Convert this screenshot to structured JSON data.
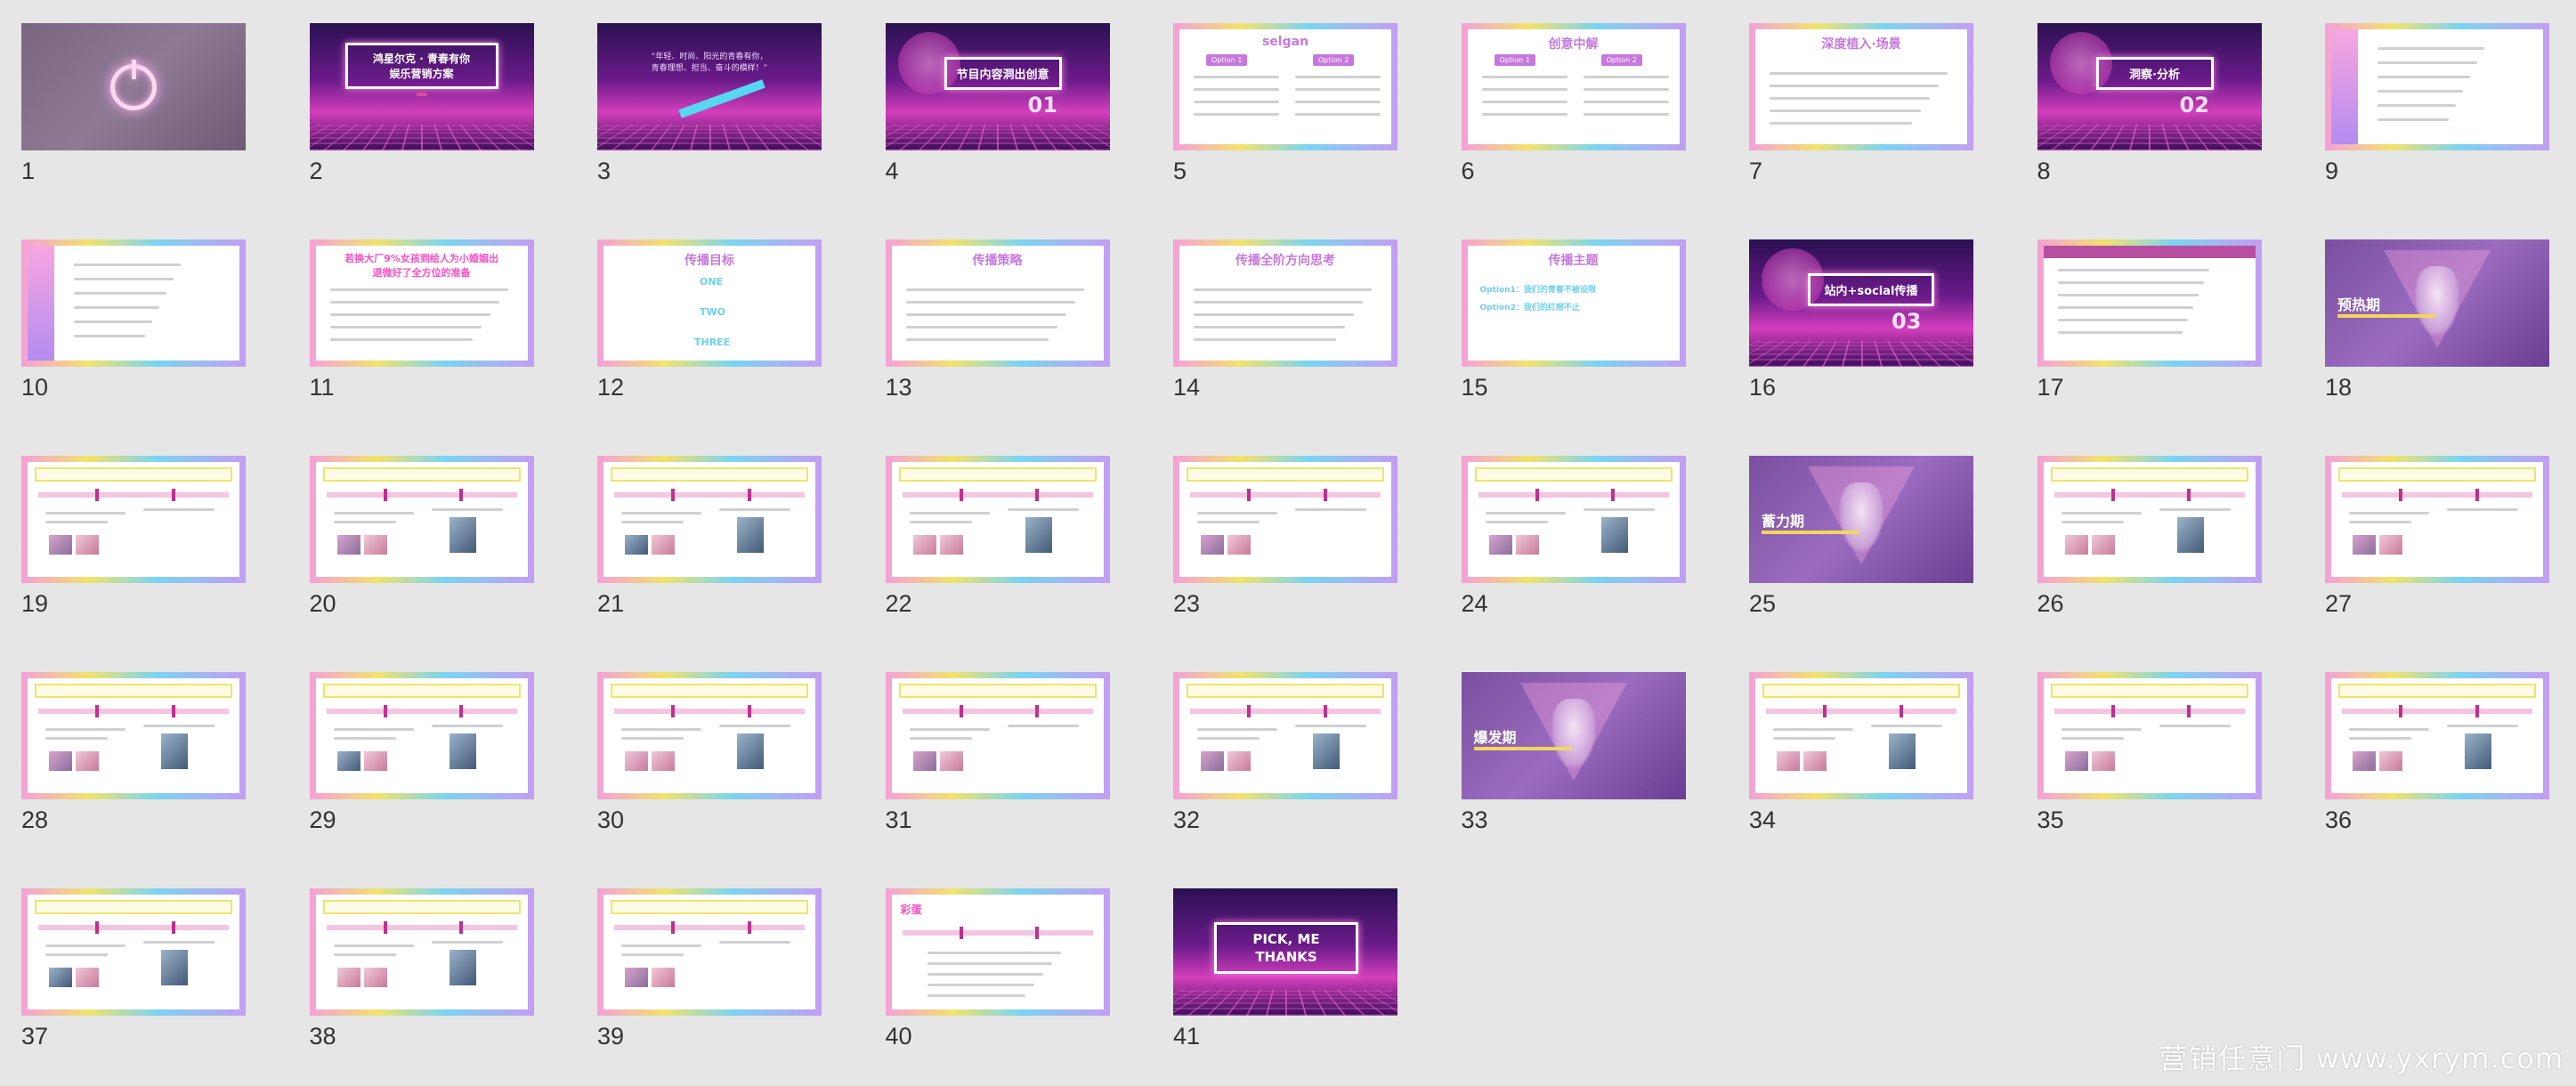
{
  "slides": [
    {
      "n": "1",
      "title": ""
    },
    {
      "n": "2",
      "title": "鸿星尔克 · 青春有你\n娱乐营销方案"
    },
    {
      "n": "3",
      "title": "“年轻、时尚、阳光的青春有你，\n青春理想、担当、奋斗的模样！”"
    },
    {
      "n": "4",
      "title": "节目内容洞出创意",
      "num": "01"
    },
    {
      "n": "5",
      "title": "selgan"
    },
    {
      "n": "6",
      "title": "创意中解"
    },
    {
      "n": "7",
      "title": "深度植入·场景"
    },
    {
      "n": "8",
      "title": "洞察·分析",
      "num": "02"
    },
    {
      "n": "9",
      "title": ""
    },
    {
      "n": "10",
      "title": ""
    },
    {
      "n": "11",
      "title": "若换大厂9%女孩到绘人为小婚姻出\n退微好了全方位的准备"
    },
    {
      "n": "12",
      "title": "传播目标"
    },
    {
      "n": "13",
      "title": "传播策略"
    },
    {
      "n": "14",
      "title": "传播全阶方向思考"
    },
    {
      "n": "15",
      "title": "传播主题"
    },
    {
      "n": "16",
      "title": "站内+social传播",
      "num": "03"
    },
    {
      "n": "17",
      "title": ""
    },
    {
      "n": "18",
      "title": "预热期"
    },
    {
      "n": "19",
      "title": ""
    },
    {
      "n": "20",
      "title": ""
    },
    {
      "n": "21",
      "title": ""
    },
    {
      "n": "22",
      "title": ""
    },
    {
      "n": "23",
      "title": ""
    },
    {
      "n": "24",
      "title": ""
    },
    {
      "n": "25",
      "title": "蓄力期"
    },
    {
      "n": "26",
      "title": ""
    },
    {
      "n": "27",
      "title": ""
    },
    {
      "n": "28",
      "title": ""
    },
    {
      "n": "29",
      "title": ""
    },
    {
      "n": "30",
      "title": ""
    },
    {
      "n": "31",
      "title": ""
    },
    {
      "n": "32",
      "title": ""
    },
    {
      "n": "33",
      "title": "爆发期"
    },
    {
      "n": "34",
      "title": ""
    },
    {
      "n": "35",
      "title": ""
    },
    {
      "n": "36",
      "title": ""
    },
    {
      "n": "37",
      "title": ""
    },
    {
      "n": "38",
      "title": ""
    },
    {
      "n": "39",
      "title": ""
    },
    {
      "n": "40",
      "title": "彩蛋"
    },
    {
      "n": "41",
      "title": "PICK, ME\nTHANKS"
    }
  ],
  "slide5": {
    "option1": "Option 1",
    "option2": "Option 2"
  },
  "slide6": {
    "option1": "Option 1",
    "option2": "Option 2"
  },
  "slide12": {
    "one": "ONE",
    "two": "TWO",
    "three": "THREE"
  },
  "slide15": {
    "line1": "Option1：我们的青春不被设限",
    "line2": "Option2：我们的红根不止"
  },
  "watermark": "营销任意门 www.yxrym.com",
  "colors": {
    "background": "#e6e6e6",
    "accent_pink": "#ff4fc2",
    "accent_cyan": "#6cd0f0",
    "frame_yellow": "#f2e36b"
  }
}
